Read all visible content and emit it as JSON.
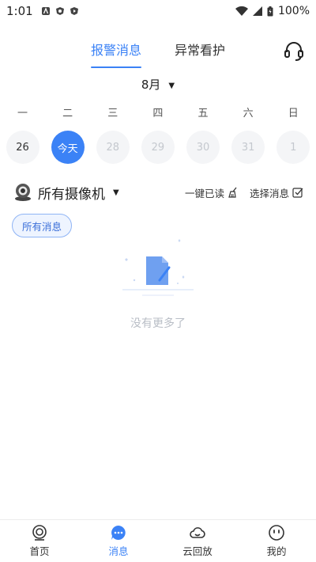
{
  "status_bar": {
    "time": "1:01",
    "battery": "100%"
  },
  "tabs": {
    "alarm": "报警消息",
    "care": "异常看护"
  },
  "month": "8月",
  "weekdays": [
    "一",
    "二",
    "三",
    "四",
    "五",
    "六",
    "日"
  ],
  "days": [
    "26",
    "今天",
    "28",
    "29",
    "30",
    "31",
    "1"
  ],
  "camera": {
    "label": "所有摄像机"
  },
  "actions": {
    "mark_read": "一键已读",
    "select": "选择消息"
  },
  "chip": {
    "label": "所有消息"
  },
  "empty": {
    "text": "没有更多了"
  },
  "nav": {
    "home": "首页",
    "messages": "消息",
    "cloud": "云回放",
    "mine": "我的"
  },
  "colors": {
    "accent": "#3b82f6"
  },
  "icons": {
    "headset": "headset-icon",
    "camera": "camera-icon",
    "broom": "broom-icon",
    "check": "checkbox-icon",
    "home": "home-camera-icon",
    "msg": "message-icon",
    "cloud": "cloud-icon",
    "mine": "face-icon"
  }
}
